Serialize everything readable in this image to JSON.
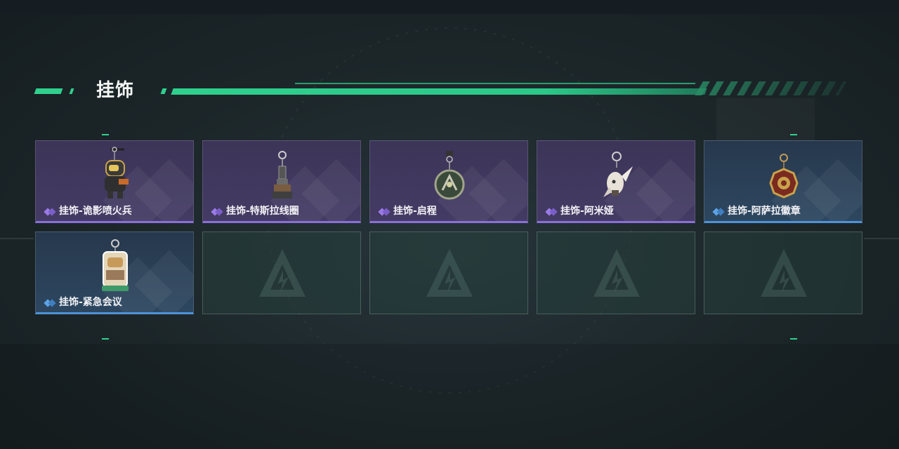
{
  "section": {
    "title": "挂饰"
  },
  "colors": {
    "accent": "#2fd08d",
    "rare_purple": "#8b6fd8",
    "rare_blue": "#4e93d8"
  },
  "items": [
    {
      "label": "挂饰-诡影喷火兵",
      "rarity": "purple",
      "icon": "flamethrower-charm-icon"
    },
    {
      "label": "挂饰-特斯拉线圈",
      "rarity": "purple",
      "icon": "tesla-coil-charm-icon"
    },
    {
      "label": "挂饰-启程",
      "rarity": "purple",
      "icon": "compass-charm-icon"
    },
    {
      "label": "挂饰-阿米娅",
      "rarity": "purple",
      "icon": "bunny-charm-icon"
    },
    {
      "label": "挂饰-阿萨拉徽章",
      "rarity": "blue",
      "icon": "badge-charm-icon"
    },
    {
      "label": "挂饰-紧急会议",
      "rarity": "blue",
      "icon": "meeting-charm-icon"
    }
  ],
  "empty_slot_icon": "delta-logo-icon"
}
